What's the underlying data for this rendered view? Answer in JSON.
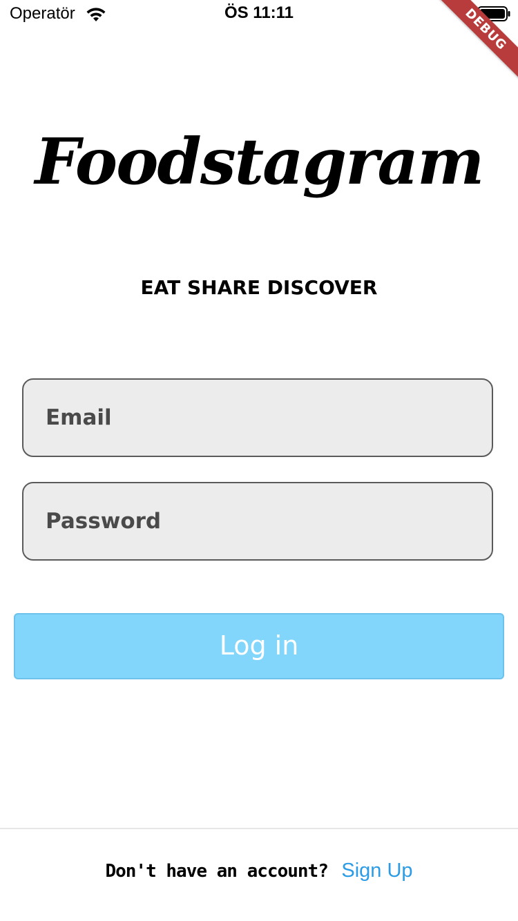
{
  "status_bar": {
    "carrier": "Operatör",
    "time": "ÖS 11:11",
    "wifi_icon": "wifi-icon",
    "battery_icon": "battery-icon"
  },
  "debug_banner": {
    "label": "DEBUG",
    "color": "#b93c3c"
  },
  "app": {
    "logo": "Foodstagram",
    "tagline": "EAT SHARE DISCOVER"
  },
  "form": {
    "email_placeholder": "Email",
    "password_placeholder": "Password",
    "login_label": "Log in",
    "login_color": "#82d6fc"
  },
  "footer": {
    "question": "Don't have an account?",
    "signup_label": "Sign Up",
    "link_color": "#2b9be6"
  }
}
